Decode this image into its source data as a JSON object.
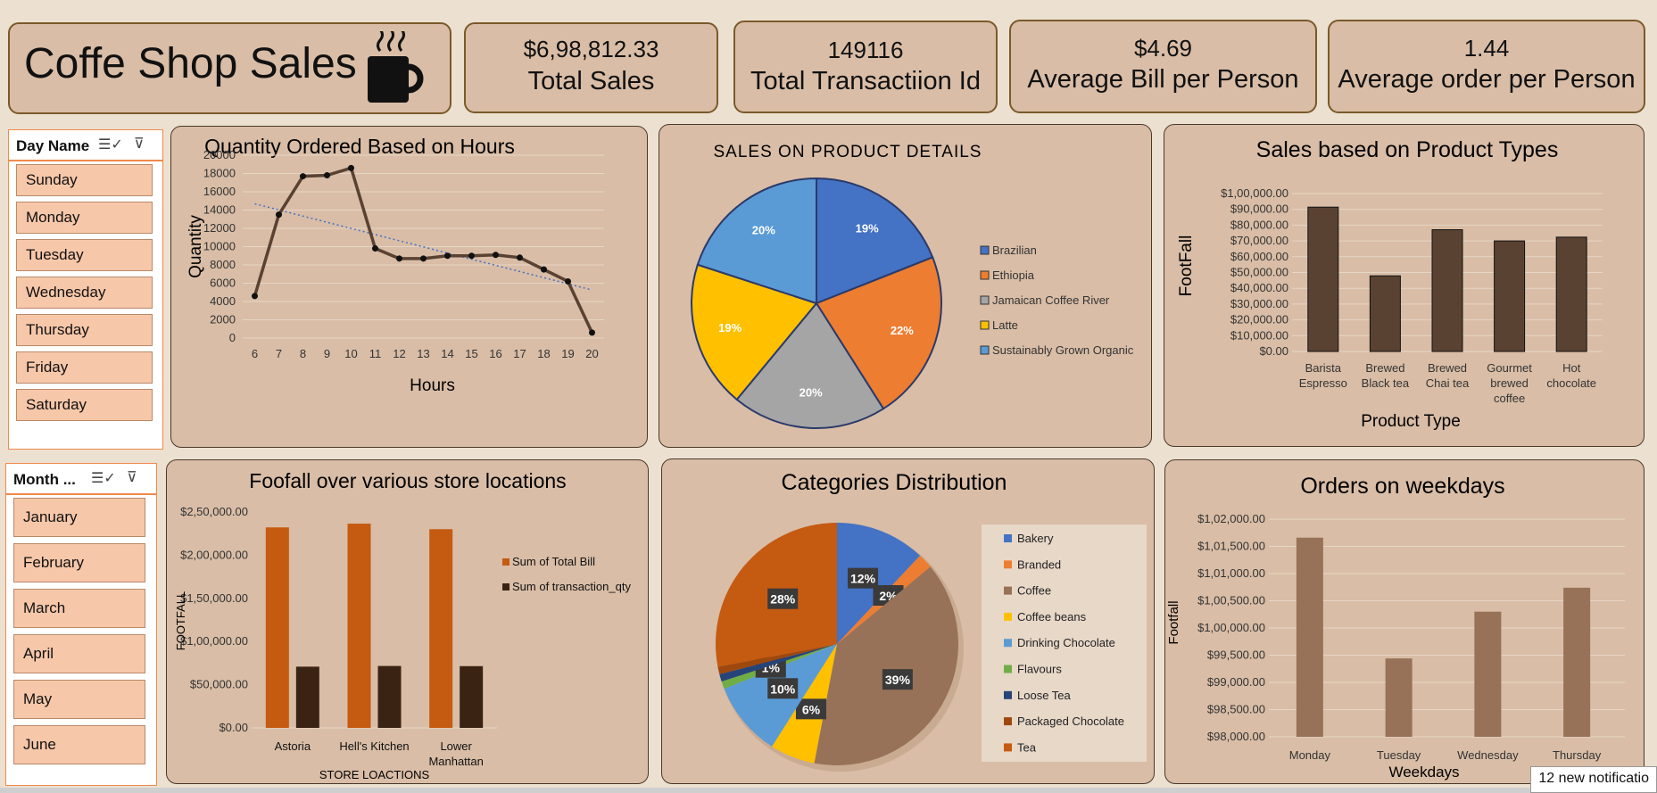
{
  "header": {
    "title": "Coffe Shop Sales",
    "icon": "coffee-cup-icon"
  },
  "kpis": [
    {
      "value": "$6,98,812.33",
      "label": "Total Sales"
    },
    {
      "value": "149116",
      "label": "Total Transactiion Id"
    },
    {
      "value": "$4.69",
      "label": "Average Bill per  Person"
    },
    {
      "value": "1.44",
      "label": "Average order per Person"
    }
  ],
  "slicers": {
    "day": {
      "title": "Day Name",
      "items": [
        "Sunday",
        "Monday",
        "Tuesday",
        "Wednesday",
        "Thursday",
        "Friday",
        "Saturday"
      ]
    },
    "month": {
      "title": "Month ...",
      "items": [
        "January",
        "February",
        "March",
        "April",
        "May",
        "June"
      ]
    }
  },
  "status": {
    "notifications": "12 new notificatio"
  },
  "colors": {
    "brown": "#5a4232",
    "orange": "#c55a11",
    "dark": "#3b2314",
    "lightBrown": "#987258"
  },
  "chart_data": [
    {
      "type": "line",
      "title": "Quantity Ordered Based on Hours",
      "xlabel": "Hours",
      "ylabel": "Quantity",
      "x": [
        6,
        7,
        8,
        9,
        10,
        11,
        12,
        13,
        14,
        15,
        16,
        17,
        18,
        19,
        20
      ],
      "values": [
        4600,
        13500,
        17700,
        17800,
        18600,
        9800,
        8700,
        8700,
        9000,
        9000,
        9100,
        8800,
        7500,
        6200,
        600
      ],
      "ylim": [
        0,
        20000
      ],
      "yticks": [
        0,
        2000,
        4000,
        6000,
        8000,
        10000,
        12000,
        14000,
        16000,
        18000,
        20000
      ],
      "trendline": true,
      "grid": true
    },
    {
      "type": "pie",
      "title": "SALES ON PRODUCT DETAILS",
      "labels": [
        "Brazilian",
        "Ethiopia",
        "Jamaican Coffee River",
        "Latte",
        "Sustainably Grown Organic"
      ],
      "values": [
        19,
        22,
        20,
        19,
        20
      ],
      "colors": [
        "#4472c4",
        "#ed7d31",
        "#a5a5a5",
        "#ffc000",
        "#5b9bd5"
      ],
      "legend": "right"
    },
    {
      "type": "bar",
      "title": "Sales based on Product Types",
      "xlabel": "Product Type",
      "ylabel": "FootFall",
      "categories": [
        "Barista Espresso",
        "Brewed Black tea",
        "Brewed Chai tea",
        "Gourmet brewed coffee",
        "Hot chocolate"
      ],
      "values": [
        91400,
        47900,
        77100,
        70000,
        72400
      ],
      "ylim": [
        0,
        100000
      ],
      "yticks": [
        "$0.00",
        "$10,000.00",
        "$20,000.00",
        "$30,000.00",
        "$40,000.00",
        "$50,000.00",
        "$60,000.00",
        "$70,000.00",
        "$80,000.00",
        "$90,000.00",
        "$1,00,000.00"
      ],
      "grid": true
    },
    {
      "type": "bar",
      "title": "Foofall over various store locations",
      "xlabel": "STORE LOACTIONS",
      "ylabel": "FOOTFALL",
      "categories": [
        "Astoria",
        "Hell's Kitchen",
        "Lower Manhattan"
      ],
      "series": [
        {
          "name": "Sum of Total Bill",
          "values": [
            232200,
            236500,
            230100
          ]
        },
        {
          "name": "Sum of transaction_qty",
          "values": [
            70900,
            71700,
            71500
          ]
        }
      ],
      "ylim": [
        0,
        250000
      ],
      "yticks": [
        "$0.00",
        "$50,000.00",
        "$1,00,000.00",
        "$1,50,000.00",
        "$2,00,000.00",
        "$2,50,000.00"
      ],
      "legend": "right"
    },
    {
      "type": "pie",
      "title": "Categories Distribution",
      "labels": [
        "Bakery",
        "Branded",
        "Coffee",
        "Coffee beans",
        "Drinking Chocolate",
        "Flavours",
        "Loose Tea",
        "Packaged Chocolate",
        "Tea"
      ],
      "values": [
        12,
        2,
        39,
        6,
        10,
        1,
        1,
        1,
        28
      ],
      "colors": [
        "#4472c4",
        "#ed7d31",
        "#987258",
        "#ffc000",
        "#5b9bd5",
        "#70ad47",
        "#264478",
        "#9e480e",
        "#c55a11"
      ],
      "datalabels": [
        "12%",
        "2%",
        "39%",
        "6%",
        "10%",
        "1%",
        "",
        "",
        "28%"
      ],
      "legend": "right"
    },
    {
      "type": "bar",
      "title": "Orders on weekdays",
      "xlabel": "Weekdays",
      "ylabel": "Footfall",
      "categories": [
        "Monday",
        "Tuesday",
        "Wednesday",
        "Thursday"
      ],
      "values": [
        101660,
        99440,
        100300,
        100740
      ],
      "ylim": [
        98000,
        102000
      ],
      "yticks": [
        "$98,000.00",
        "$98,500.00",
        "$99,000.00",
        "$99,500.00",
        "$1,00,000.00",
        "$1,00,500.00",
        "$1,01,000.00",
        "$1,01,500.00",
        "$1,02,000.00"
      ],
      "grid": true
    }
  ]
}
